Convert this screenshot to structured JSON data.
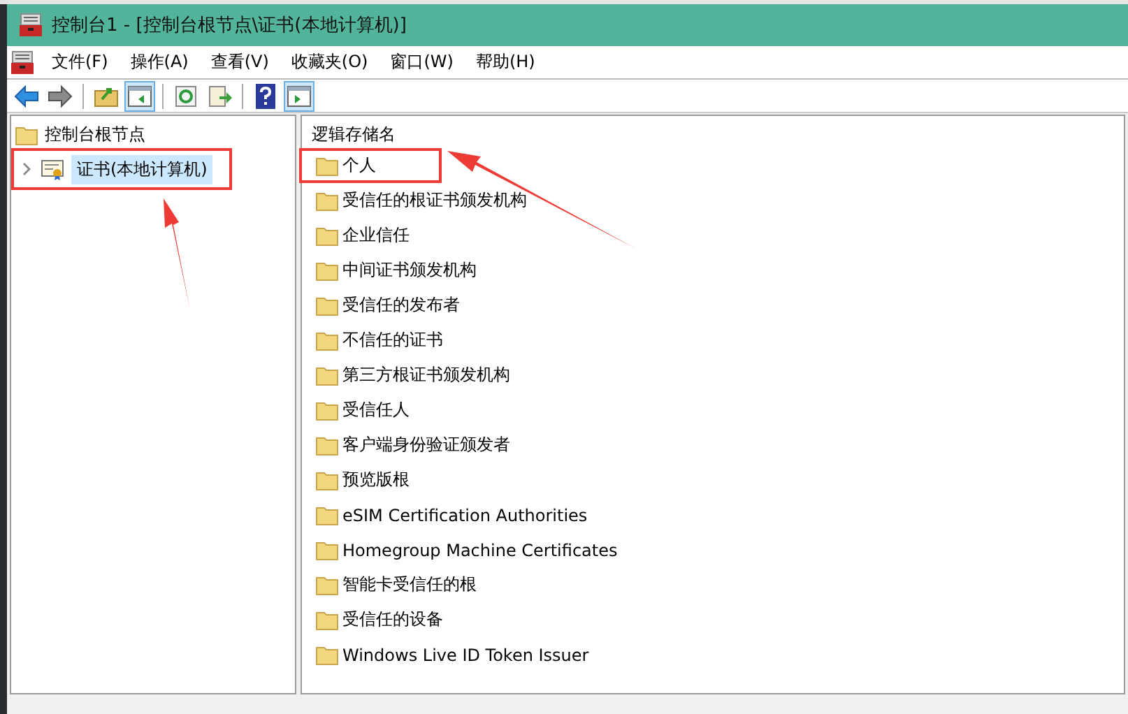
{
  "window": {
    "title": "控制台1 - [控制台根节点\\证书(本地计算机)]"
  },
  "menu": [
    "文件(F)",
    "操作(A)",
    "查看(V)",
    "收藏夹(O)",
    "窗口(W)",
    "帮助(H)"
  ],
  "toolbar": [
    [
      {
        "kind": "back",
        "on": false
      },
      {
        "kind": "forward",
        "on": false
      }
    ],
    [
      {
        "kind": "up",
        "on": false
      },
      {
        "kind": "tree",
        "on": true
      }
    ],
    [
      {
        "kind": "refresh",
        "on": false
      },
      {
        "kind": "export",
        "on": false
      }
    ],
    [
      {
        "kind": "help",
        "on": false
      },
      {
        "kind": "action",
        "on": true
      }
    ]
  ],
  "tree": {
    "label": "控制台根节点",
    "children": [
      {
        "label": "证书(本地计算机)",
        "selected": true,
        "expanded": false,
        "highlighted": true
      }
    ]
  },
  "list": {
    "column": "逻辑存储名",
    "items": [
      {
        "label": "个人",
        "highlighted": true
      },
      {
        "label": "受信任的根证书颁发机构",
        "highlighted": false
      },
      {
        "label": "企业信任",
        "highlighted": false
      },
      {
        "label": "中间证书颁发机构",
        "highlighted": false
      },
      {
        "label": "受信任的发布者",
        "highlighted": false
      },
      {
        "label": "不信任的证书",
        "highlighted": false
      },
      {
        "label": "第三方根证书颁发机构",
        "highlighted": false
      },
      {
        "label": "受信任人",
        "highlighted": false
      },
      {
        "label": "客户端身份验证颁发者",
        "highlighted": false
      },
      {
        "label": "预览版根",
        "highlighted": false
      },
      {
        "label": "eSIM Certification Authorities",
        "highlighted": false
      },
      {
        "label": "Homegroup Machine Certificates",
        "highlighted": false
      },
      {
        "label": "智能卡受信任的根",
        "highlighted": false
      },
      {
        "label": "受信任的设备",
        "highlighted": false
      },
      {
        "label": "Windows Live ID Token Issuer",
        "highlighted": false
      }
    ]
  }
}
